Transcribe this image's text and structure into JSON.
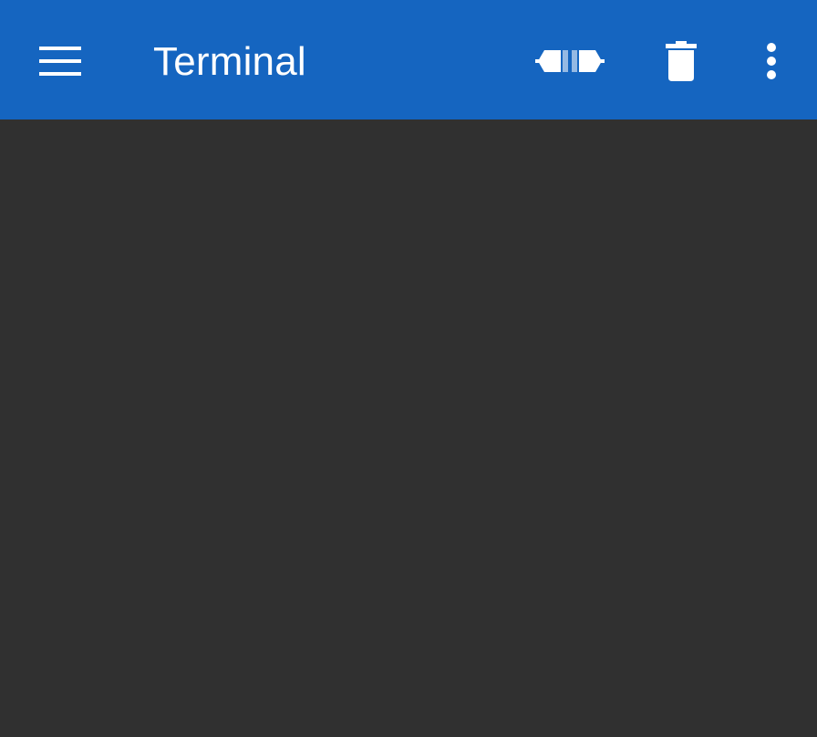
{
  "toolbar": {
    "title": "Terminal",
    "background_color": "#1565C0",
    "icons": {
      "menu": "menu-icon",
      "connect": "connect-plug-icon",
      "delete": "trash-icon",
      "more": "more-vertical-icon"
    }
  },
  "terminal": {
    "background_color": "#303030",
    "output": ""
  }
}
